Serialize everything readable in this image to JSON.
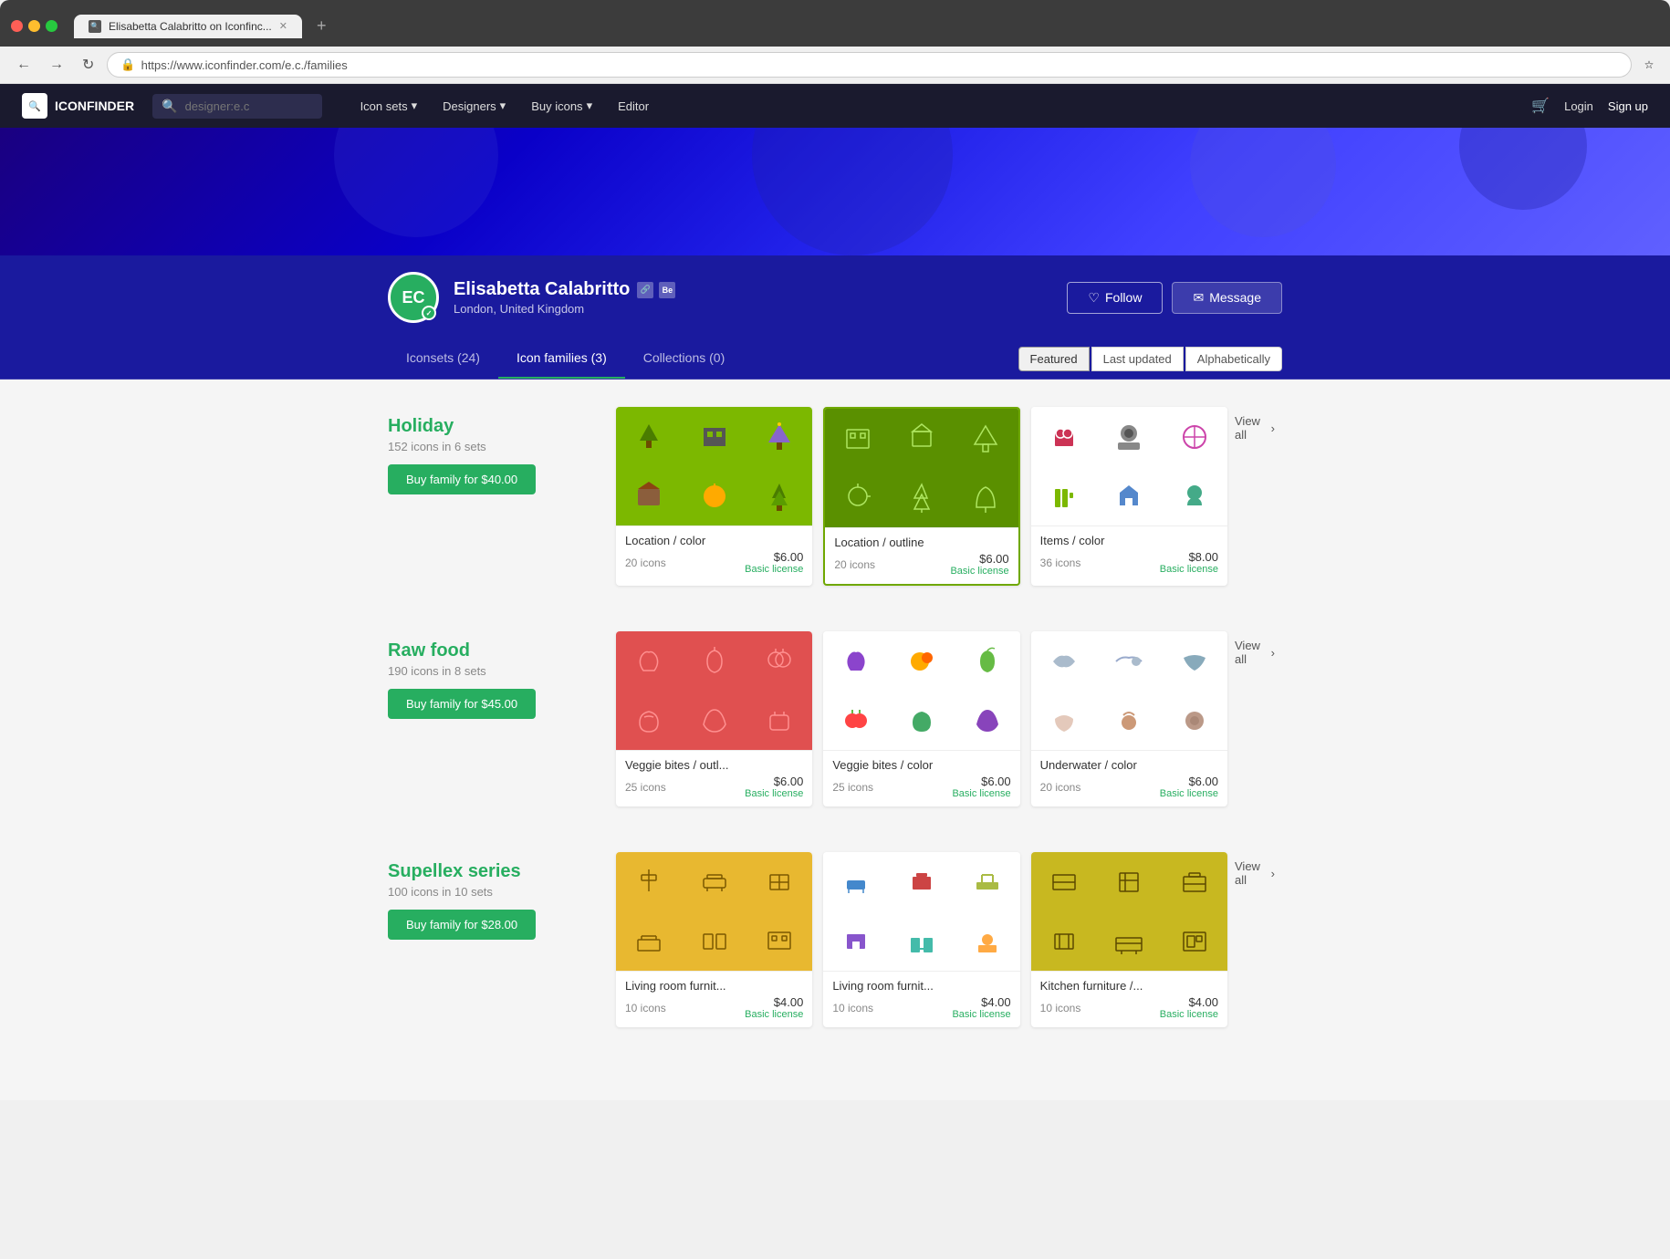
{
  "browser": {
    "tab_title": "Elisabetta Calabritto on Iconfinc...",
    "url": "https://www.iconfinder.com/e.c./families",
    "new_tab_label": "+",
    "nav_back": "←",
    "nav_forward": "→",
    "nav_refresh": "↻"
  },
  "navbar": {
    "logo_text": "ICONFINDER",
    "search_placeholder": "designer:e.c",
    "search_icon": "🔍",
    "nav_items": [
      {
        "label": "Icon sets",
        "has_arrow": true
      },
      {
        "label": "Designers",
        "has_arrow": true
      },
      {
        "label": "Buy icons",
        "has_arrow": true
      },
      {
        "label": "Editor"
      }
    ],
    "login_label": "Login",
    "signup_label": "Sign up",
    "cart_icon": "🛒"
  },
  "profile": {
    "initials": "ec",
    "name": "Elisabetta Calabritto",
    "location": "London, United Kingdom",
    "follow_label": "Follow",
    "message_label": "Message",
    "verified_icon": "✓",
    "behance_icon": "Be"
  },
  "tabs": {
    "items": [
      {
        "label": "Iconsets (24)",
        "active": false
      },
      {
        "label": "Icon families (3)",
        "active": true
      },
      {
        "label": "Collections (0)",
        "active": false
      }
    ],
    "sort_options": [
      {
        "label": "Featured",
        "active": true
      },
      {
        "label": "Last updated",
        "active": false
      },
      {
        "label": "Alphabetically",
        "active": false
      }
    ]
  },
  "families": [
    {
      "name": "Holiday",
      "meta": "152 icons in 6 sets",
      "buy_label": "Buy family for $40.00",
      "sets": [
        {
          "name": "Location / color",
          "count": "20 icons",
          "price": "$6.00",
          "license": "Basic license",
          "bg_color": "#7cb800",
          "icon_color": "dark"
        },
        {
          "name": "Location / outline",
          "count": "20 icons",
          "price": "$6.00",
          "license": "Basic license",
          "bg_color": "#6fa800",
          "icon_color": "light"
        },
        {
          "name": "Items / color",
          "count": "36 icons",
          "price": "$8.00",
          "license": "Basic license",
          "bg_color": "#ffffff",
          "icon_color": "color"
        }
      ],
      "view_all_label": "View all"
    },
    {
      "name": "Raw food",
      "meta": "190 icons in 8 sets",
      "buy_label": "Buy family for $45.00",
      "sets": [
        {
          "name": "Veggie bites / outl...",
          "count": "25 icons",
          "price": "$6.00",
          "license": "Basic license",
          "bg_color": "#e05050",
          "icon_color": "light"
        },
        {
          "name": "Veggie bites / color",
          "count": "25 icons",
          "price": "$6.00",
          "license": "Basic license",
          "bg_color": "#ffffff",
          "icon_color": "color"
        },
        {
          "name": "Underwater / color",
          "count": "20 icons",
          "price": "$6.00",
          "license": "Basic license",
          "bg_color": "#ffffff",
          "icon_color": "color"
        }
      ],
      "view_all_label": "View all"
    },
    {
      "name": "Supellex series",
      "meta": "100 icons in 10 sets",
      "buy_label": "Buy family for $28.00",
      "sets": [
        {
          "name": "Living room furnit...",
          "count": "10 icons",
          "price": "$4.00",
          "license": "Basic license",
          "bg_color": "#e8b830",
          "icon_color": "dark"
        },
        {
          "name": "Living room furnit...",
          "count": "10 icons",
          "price": "$4.00",
          "license": "Basic license",
          "bg_color": "#ffffff",
          "icon_color": "color"
        },
        {
          "name": "Kitchen furniture /...",
          "count": "10 icons",
          "price": "$4.00",
          "license": "Basic license",
          "bg_color": "#c8b820",
          "icon_color": "dark"
        }
      ],
      "view_all_label": "View all"
    }
  ]
}
